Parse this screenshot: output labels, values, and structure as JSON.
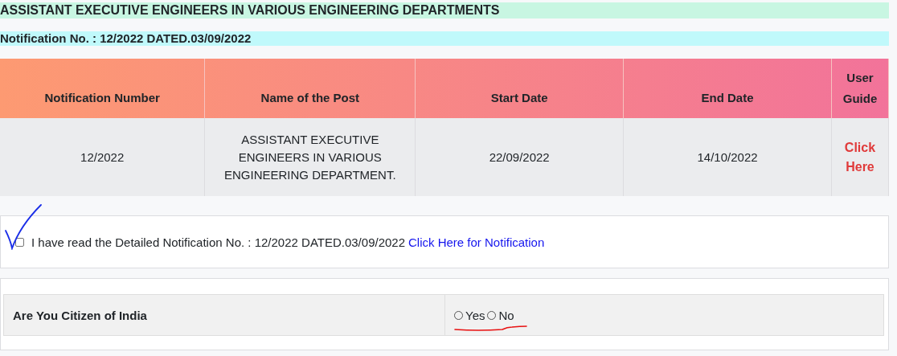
{
  "title": "ASSISTANT EXECUTIVE ENGINEERS IN VARIOUS ENGINEERING DEPARTMENTS",
  "notification": "Notification No. : 12/2022 DATED.03/09/2022",
  "table": {
    "columns": [
      "Notification Number",
      "Name of the Post",
      "Start Date",
      "End Date",
      "User Guide"
    ],
    "rows": [
      {
        "notification_number": "12/2022",
        "post": "ASSISTANT EXECUTIVE ENGINEERS IN VARIOUS ENGINEERING DEPARTMENT.",
        "start_date": "22/09/2022",
        "end_date": "14/10/2022",
        "user_guide_link": "Click Here"
      }
    ]
  },
  "declaration": {
    "checked": false,
    "text": "I have read the Detailed Notification No. : 12/2022 DATED.03/09/2022",
    "link": "Click Here for Notification"
  },
  "citizen_question": {
    "label": "Are You Citizen of India",
    "options": [
      {
        "label": "Yes",
        "selected": false
      },
      {
        "label": "No",
        "selected": false
      }
    ]
  }
}
